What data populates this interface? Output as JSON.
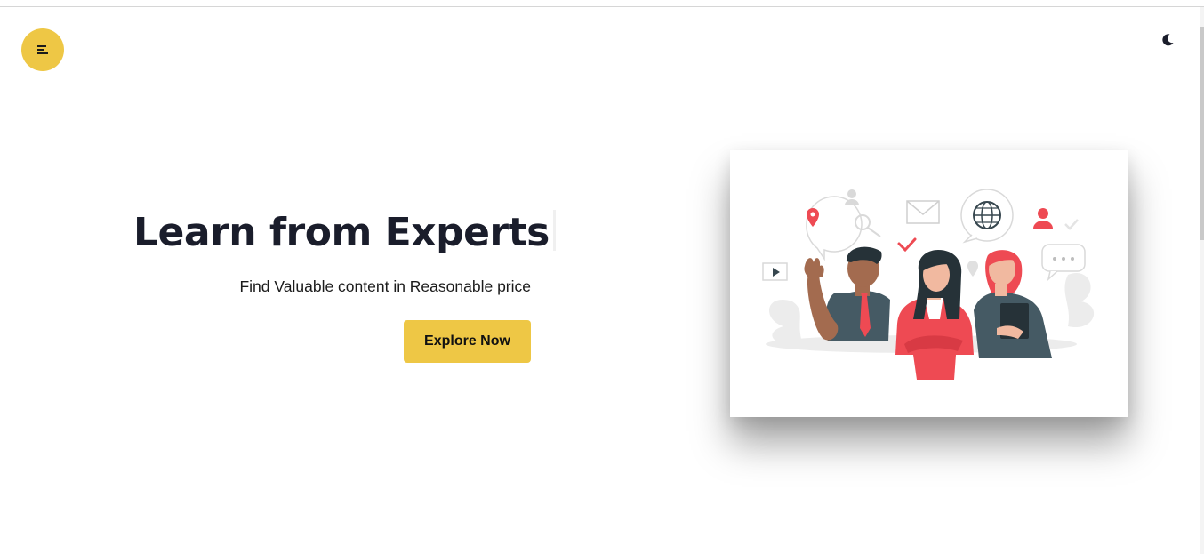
{
  "page": {
    "background": "#ffffff",
    "accent": "#eec745",
    "text_color": "#1a1d2b"
  },
  "nav": {
    "menu_icon": "hamburger-menu-icon",
    "theme_icon": "moon-icon"
  },
  "hero": {
    "title": "Learn from Experts",
    "subtitle": "Find Valuable content in Reasonable price",
    "cta_label": "Explore Now",
    "illustration": "team-of-experts-illustration"
  }
}
